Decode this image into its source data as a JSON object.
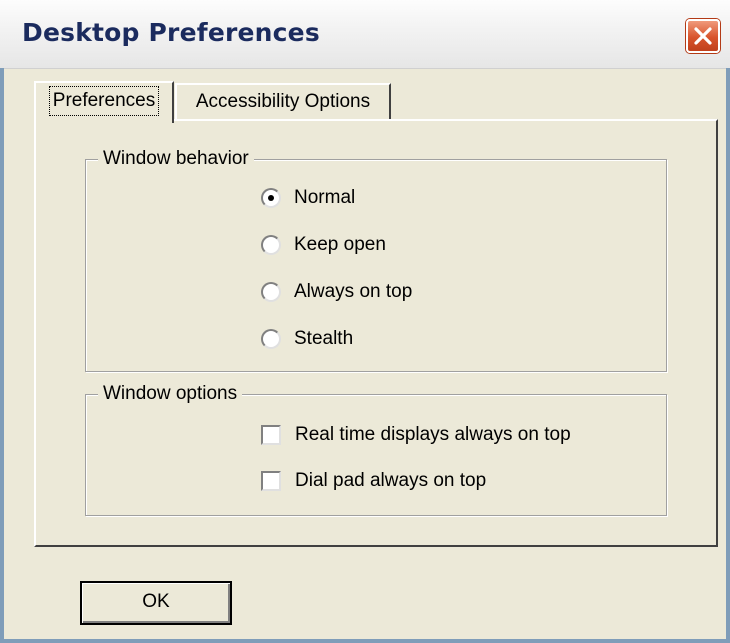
{
  "window": {
    "title": "Desktop Preferences"
  },
  "tabs": [
    {
      "label": "Preferences",
      "selected": true
    },
    {
      "label": "Accessibility Options",
      "selected": false
    }
  ],
  "window_behavior": {
    "title": "Window behavior",
    "options": [
      {
        "label": "Normal",
        "checked": true
      },
      {
        "label": "Keep open",
        "checked": false
      },
      {
        "label": "Always on top",
        "checked": false
      },
      {
        "label": "Stealth",
        "checked": false
      }
    ]
  },
  "window_options": {
    "title": "Window options",
    "options": [
      {
        "label": "Real time displays always on top",
        "checked": false
      },
      {
        "label": "Dial pad always on top",
        "checked": false
      }
    ]
  },
  "buttons": {
    "ok": "OK"
  },
  "colors": {
    "close_button": "#d8542c",
    "title_text": "#1b2b5e",
    "dialog_face": "#ece9d8"
  }
}
